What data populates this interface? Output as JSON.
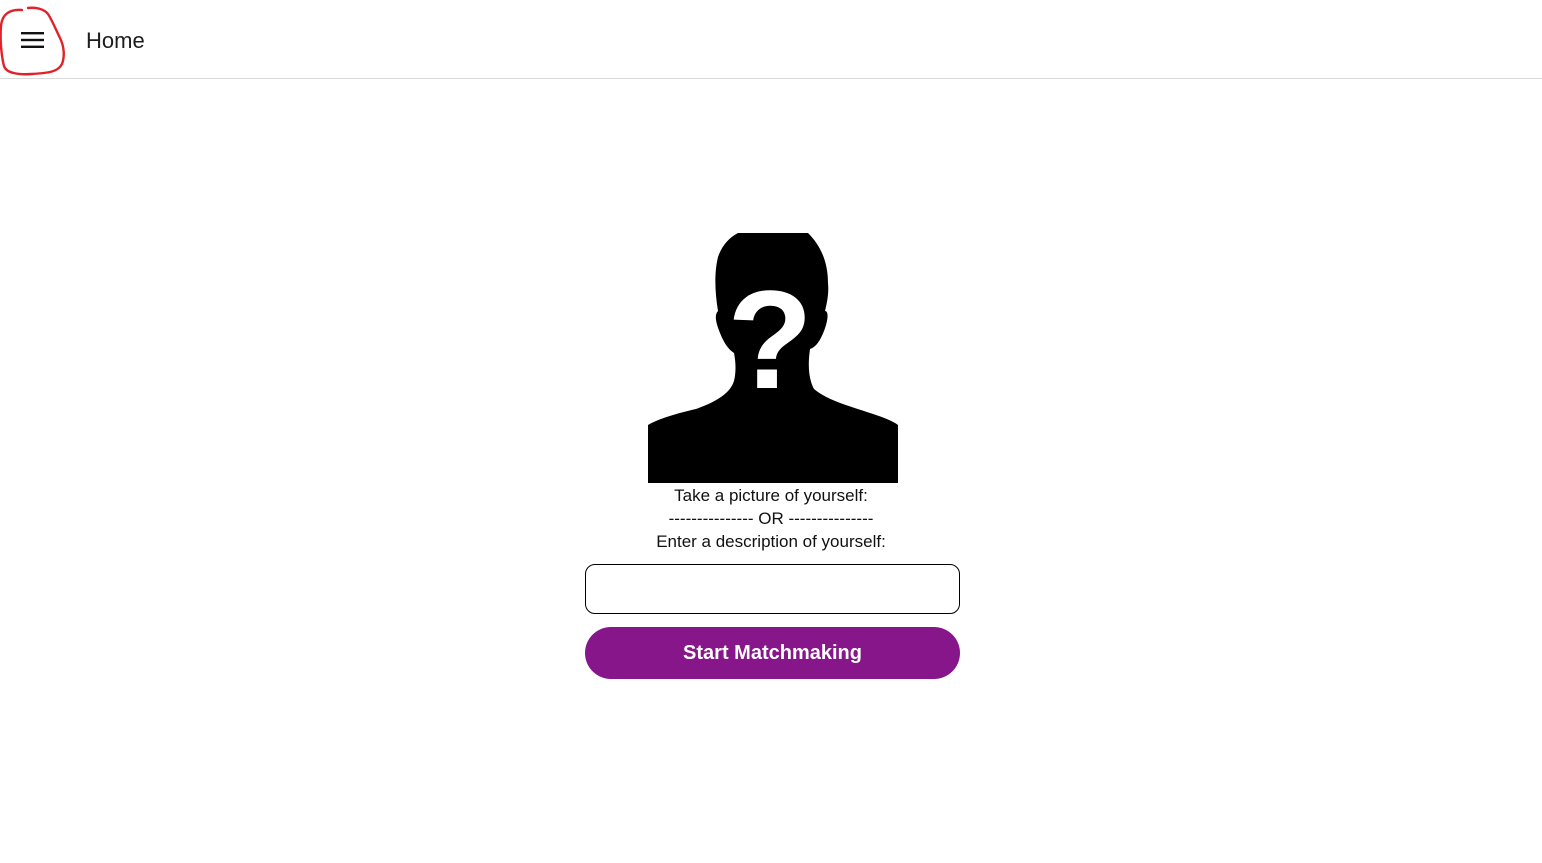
{
  "header": {
    "title": "Home",
    "menu_icon": "hamburger-menu-icon",
    "annotation_color": "#e0222a"
  },
  "main": {
    "avatar_icon": "unknown-person-silhouette-icon",
    "prompt_picture": "Take a picture of yourself:",
    "separator": "--------------- OR ---------------",
    "prompt_description": "Enter a description of yourself:",
    "description_input": {
      "value": "",
      "placeholder": ""
    },
    "start_button_label": "Start Matchmaking",
    "start_button_color": "#86168a"
  }
}
